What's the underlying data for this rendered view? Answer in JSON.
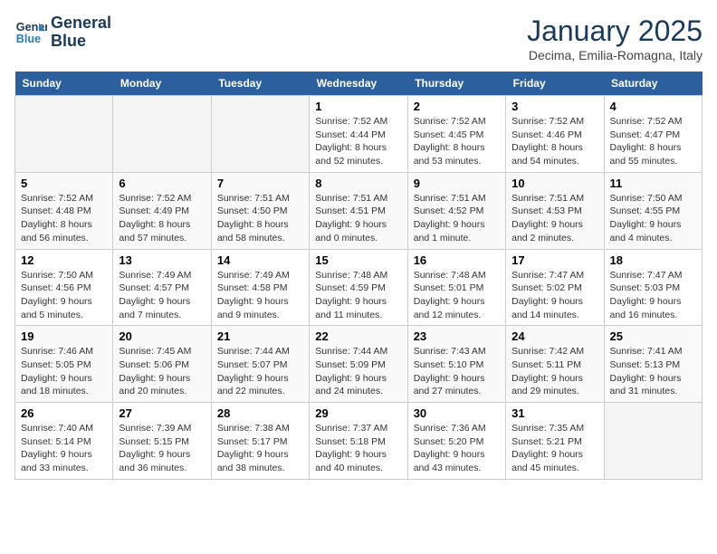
{
  "logo": {
    "line1": "General",
    "line2": "Blue"
  },
  "title": "January 2025",
  "subtitle": "Decima, Emilia-Romagna, Italy",
  "days_of_week": [
    "Sunday",
    "Monday",
    "Tuesday",
    "Wednesday",
    "Thursday",
    "Friday",
    "Saturday"
  ],
  "weeks": [
    [
      {
        "day": "",
        "info": ""
      },
      {
        "day": "",
        "info": ""
      },
      {
        "day": "",
        "info": ""
      },
      {
        "day": "1",
        "info": "Sunrise: 7:52 AM\nSunset: 4:44 PM\nDaylight: 8 hours and 52 minutes."
      },
      {
        "day": "2",
        "info": "Sunrise: 7:52 AM\nSunset: 4:45 PM\nDaylight: 8 hours and 53 minutes."
      },
      {
        "day": "3",
        "info": "Sunrise: 7:52 AM\nSunset: 4:46 PM\nDaylight: 8 hours and 54 minutes."
      },
      {
        "day": "4",
        "info": "Sunrise: 7:52 AM\nSunset: 4:47 PM\nDaylight: 8 hours and 55 minutes."
      }
    ],
    [
      {
        "day": "5",
        "info": "Sunrise: 7:52 AM\nSunset: 4:48 PM\nDaylight: 8 hours and 56 minutes."
      },
      {
        "day": "6",
        "info": "Sunrise: 7:52 AM\nSunset: 4:49 PM\nDaylight: 8 hours and 57 minutes."
      },
      {
        "day": "7",
        "info": "Sunrise: 7:51 AM\nSunset: 4:50 PM\nDaylight: 8 hours and 58 minutes."
      },
      {
        "day": "8",
        "info": "Sunrise: 7:51 AM\nSunset: 4:51 PM\nDaylight: 9 hours and 0 minutes."
      },
      {
        "day": "9",
        "info": "Sunrise: 7:51 AM\nSunset: 4:52 PM\nDaylight: 9 hours and 1 minute."
      },
      {
        "day": "10",
        "info": "Sunrise: 7:51 AM\nSunset: 4:53 PM\nDaylight: 9 hours and 2 minutes."
      },
      {
        "day": "11",
        "info": "Sunrise: 7:50 AM\nSunset: 4:55 PM\nDaylight: 9 hours and 4 minutes."
      }
    ],
    [
      {
        "day": "12",
        "info": "Sunrise: 7:50 AM\nSunset: 4:56 PM\nDaylight: 9 hours and 5 minutes."
      },
      {
        "day": "13",
        "info": "Sunrise: 7:49 AM\nSunset: 4:57 PM\nDaylight: 9 hours and 7 minutes."
      },
      {
        "day": "14",
        "info": "Sunrise: 7:49 AM\nSunset: 4:58 PM\nDaylight: 9 hours and 9 minutes."
      },
      {
        "day": "15",
        "info": "Sunrise: 7:48 AM\nSunset: 4:59 PM\nDaylight: 9 hours and 11 minutes."
      },
      {
        "day": "16",
        "info": "Sunrise: 7:48 AM\nSunset: 5:01 PM\nDaylight: 9 hours and 12 minutes."
      },
      {
        "day": "17",
        "info": "Sunrise: 7:47 AM\nSunset: 5:02 PM\nDaylight: 9 hours and 14 minutes."
      },
      {
        "day": "18",
        "info": "Sunrise: 7:47 AM\nSunset: 5:03 PM\nDaylight: 9 hours and 16 minutes."
      }
    ],
    [
      {
        "day": "19",
        "info": "Sunrise: 7:46 AM\nSunset: 5:05 PM\nDaylight: 9 hours and 18 minutes."
      },
      {
        "day": "20",
        "info": "Sunrise: 7:45 AM\nSunset: 5:06 PM\nDaylight: 9 hours and 20 minutes."
      },
      {
        "day": "21",
        "info": "Sunrise: 7:44 AM\nSunset: 5:07 PM\nDaylight: 9 hours and 22 minutes."
      },
      {
        "day": "22",
        "info": "Sunrise: 7:44 AM\nSunset: 5:09 PM\nDaylight: 9 hours and 24 minutes."
      },
      {
        "day": "23",
        "info": "Sunrise: 7:43 AM\nSunset: 5:10 PM\nDaylight: 9 hours and 27 minutes."
      },
      {
        "day": "24",
        "info": "Sunrise: 7:42 AM\nSunset: 5:11 PM\nDaylight: 9 hours and 29 minutes."
      },
      {
        "day": "25",
        "info": "Sunrise: 7:41 AM\nSunset: 5:13 PM\nDaylight: 9 hours and 31 minutes."
      }
    ],
    [
      {
        "day": "26",
        "info": "Sunrise: 7:40 AM\nSunset: 5:14 PM\nDaylight: 9 hours and 33 minutes."
      },
      {
        "day": "27",
        "info": "Sunrise: 7:39 AM\nSunset: 5:15 PM\nDaylight: 9 hours and 36 minutes."
      },
      {
        "day": "28",
        "info": "Sunrise: 7:38 AM\nSunset: 5:17 PM\nDaylight: 9 hours and 38 minutes."
      },
      {
        "day": "29",
        "info": "Sunrise: 7:37 AM\nSunset: 5:18 PM\nDaylight: 9 hours and 40 minutes."
      },
      {
        "day": "30",
        "info": "Sunrise: 7:36 AM\nSunset: 5:20 PM\nDaylight: 9 hours and 43 minutes."
      },
      {
        "day": "31",
        "info": "Sunrise: 7:35 AM\nSunset: 5:21 PM\nDaylight: 9 hours and 45 minutes."
      },
      {
        "day": "",
        "info": ""
      }
    ]
  ]
}
